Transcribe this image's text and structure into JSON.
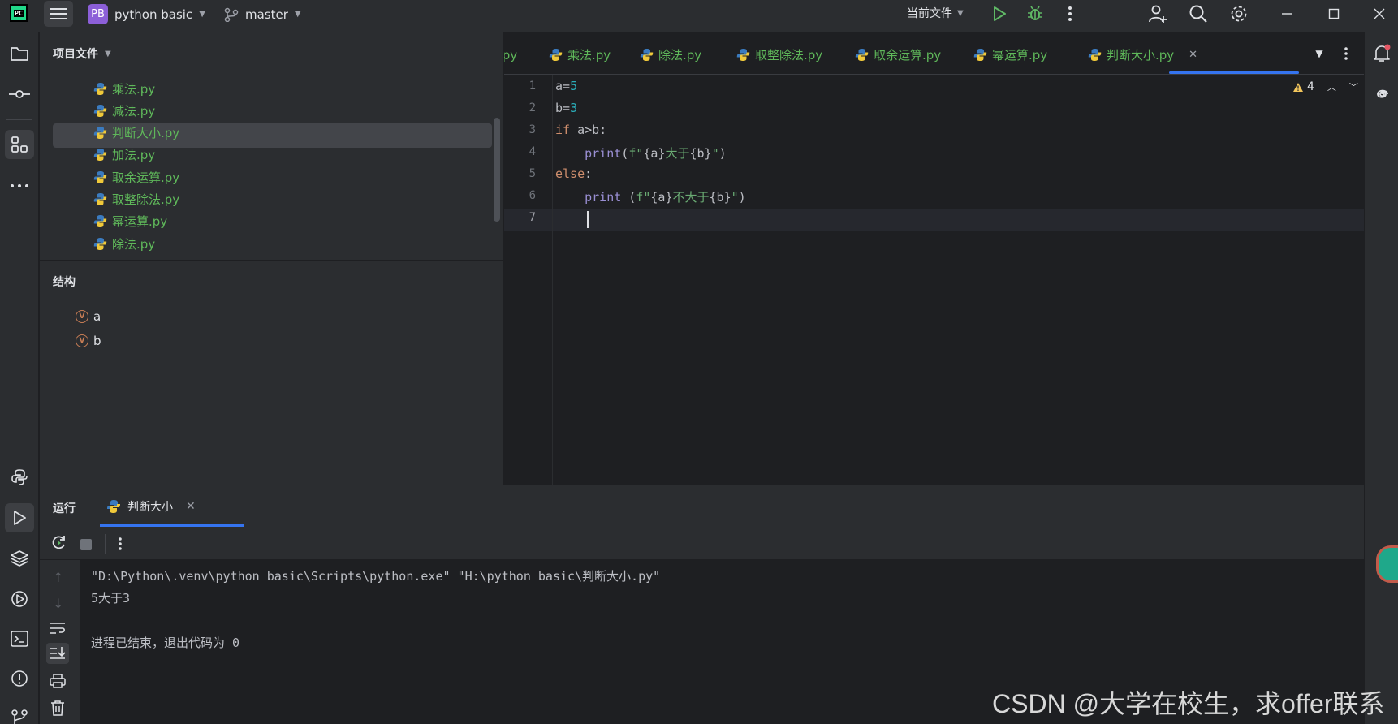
{
  "titlebar": {
    "logo": "PC",
    "project_badge": "PB",
    "project_name": "python basic",
    "branch": "master",
    "run_config": "当前文件"
  },
  "project_panel": {
    "title": "项目文件",
    "files": [
      "乘法.py",
      "减法.py",
      "判断大小.py",
      "加法.py",
      "取余运算.py",
      "取整除法.py",
      "幂运算.py",
      "除法.py"
    ],
    "selected_index": 2
  },
  "structure_panel": {
    "title": "结构",
    "items": [
      {
        "badge": "V",
        "name": "a"
      },
      {
        "badge": "V",
        "name": "b"
      }
    ]
  },
  "editor": {
    "tabs": [
      {
        "label": "法.py"
      },
      {
        "label": "乘法.py"
      },
      {
        "label": "除法.py"
      },
      {
        "label": "取整除法.py"
      },
      {
        "label": "取余运算.py"
      },
      {
        "label": "幂运算.py"
      },
      {
        "label": "判断大小.py",
        "active": true
      }
    ],
    "warning_count": "4",
    "line_numbers": [
      "1",
      "2",
      "3",
      "4",
      "5",
      "6",
      "7"
    ],
    "current_line": 7
  },
  "run_panel": {
    "title": "运行",
    "tab_label": "判断大小",
    "console_lines": [
      "\"D:\\Python\\.venv\\python basic\\Scripts\\python.exe\" \"H:\\python basic\\判断大小.py\"",
      "5大于3",
      "",
      "进程已结束，退出代码为 0"
    ]
  },
  "watermark": "CSDN @大学在校生，求offer联系",
  "colors": {
    "background": "#1e1f22",
    "panel": "#2b2d30",
    "file_green": "#5fb85a",
    "keyword": "#cf8e6d",
    "number": "#2aacb8",
    "builtin": "#9a8fd4",
    "string": "#6aab73",
    "accent": "#3574f0",
    "run_green": "#5fb865"
  }
}
